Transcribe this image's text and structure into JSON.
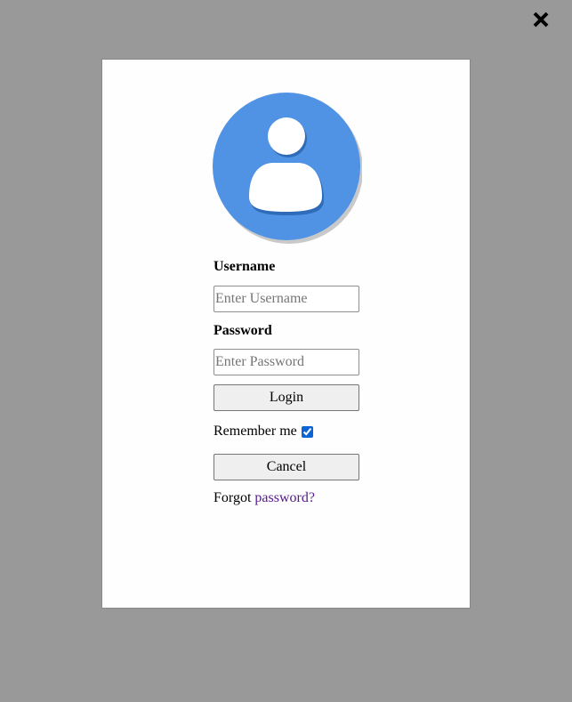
{
  "dialog": {
    "close_icon": "close-icon",
    "avatar_icon": "user-avatar-icon",
    "colors": {
      "overlay": "#999999",
      "modal": "#fefefe",
      "avatar": "#5092e3",
      "link": "#551a8b"
    }
  },
  "form": {
    "username_label": "Username",
    "username_placeholder": "Enter Username",
    "username_value": "",
    "password_label": "Password",
    "password_placeholder": "Enter Password",
    "password_value": "",
    "login_label": "Login",
    "remember_label": "Remember me",
    "remember_checked": true,
    "cancel_label": "Cancel",
    "forgot_prefix": "Forgot",
    "forgot_link": "password?"
  }
}
